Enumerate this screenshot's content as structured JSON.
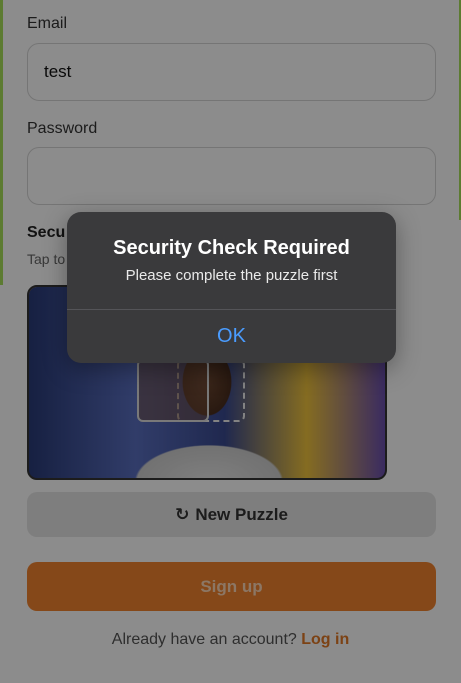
{
  "form": {
    "email_label": "Email",
    "email_value": "test",
    "password_label": "Password",
    "password_value": "",
    "security_title": "Secu",
    "security_hint": "Tap to",
    "new_puzzle_icon": "↻",
    "new_puzzle_label": "New Puzzle",
    "signup_label": "Sign up",
    "footer_text": "Already have an account?",
    "login_link": "Log in"
  },
  "alert": {
    "title": "Security Check Required",
    "message": "Please complete the puzzle first",
    "ok_label": "OK"
  },
  "colors": {
    "accent": "#f2842e",
    "link": "#e27825",
    "alert_button": "#4a9cff"
  }
}
